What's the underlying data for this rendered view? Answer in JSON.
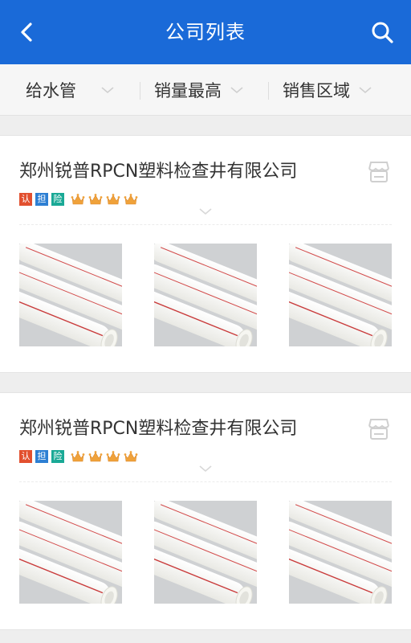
{
  "header": {
    "title": "公司列表",
    "back_icon": "back-arrow-icon",
    "search_icon": "search-icon",
    "bg_color": "#1a6ad8"
  },
  "filters": [
    {
      "label": "给水管"
    },
    {
      "label": "销量最高"
    },
    {
      "label": "销售区域"
    }
  ],
  "companies": [
    {
      "name": "郑州锐普RPCN塑料检查井有限公司",
      "badges": [
        "认",
        "担",
        "险"
      ],
      "crown_count": 4,
      "product_images": [
        "white-pipe-product",
        "white-pipe-product",
        "white-pipe-product"
      ]
    },
    {
      "name": "郑州锐普RPCN塑料检查井有限公司",
      "badges": [
        "认",
        "担",
        "险"
      ],
      "crown_count": 4,
      "product_images": [
        "white-pipe-product",
        "white-pipe-product",
        "white-pipe-product"
      ]
    }
  ],
  "colors": {
    "badge_red": "#e2502f",
    "badge_blue": "#2d7fd3",
    "badge_teal": "#1aa996",
    "crown": "#f0a23a"
  }
}
